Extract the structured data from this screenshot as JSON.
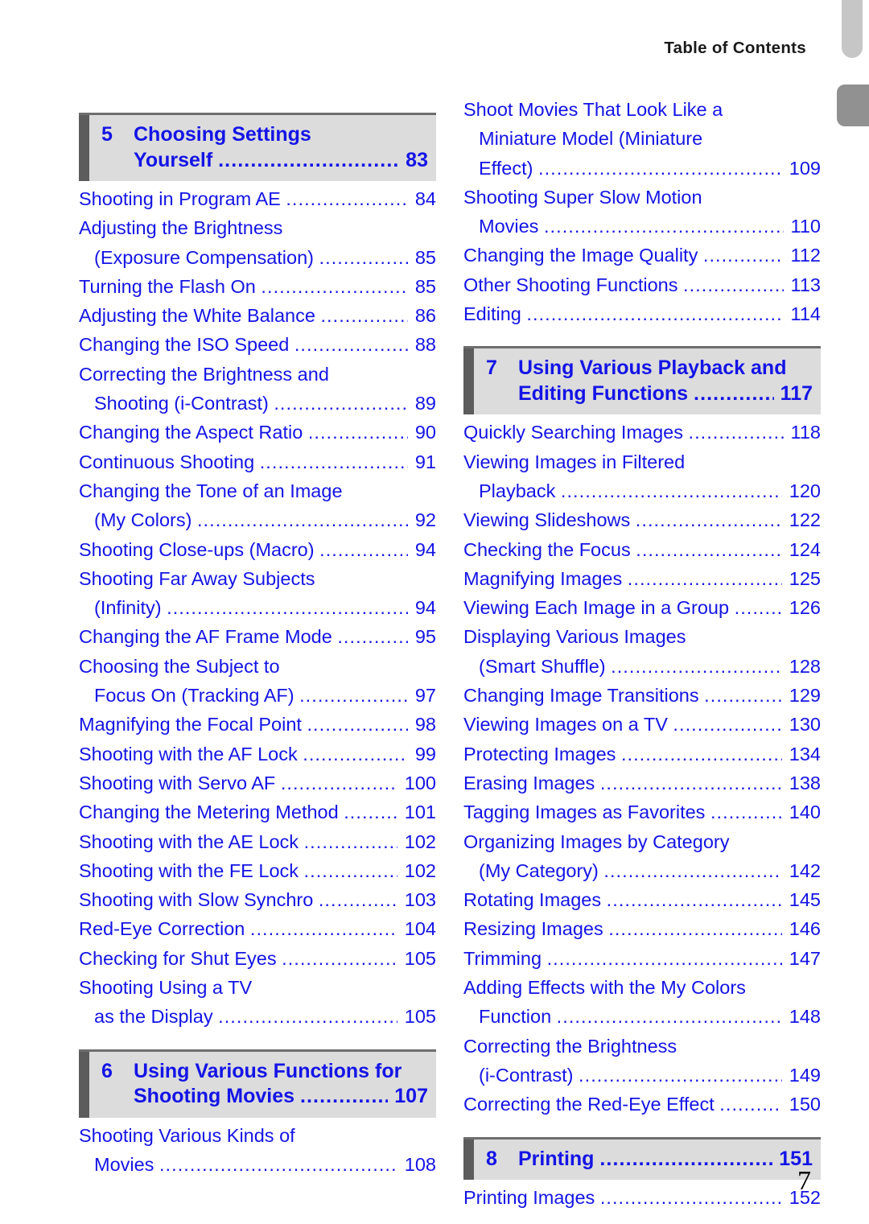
{
  "running_head": "Table of Contents",
  "folio": "7",
  "colors": {
    "link_blue": "#1414E6",
    "chapter_bar_bg": "#DCDCDC",
    "chapter_bar_accent": "#5C5C5C",
    "tab_light": "#C6C6C6",
    "tab_dark": "#919191"
  },
  "dot_leader": "........................................................................................",
  "left_column": [
    {
      "kind": "chapter",
      "number": "5",
      "lines": [
        {
          "label": "Choosing Settings",
          "dots": false,
          "page": ""
        },
        {
          "label": "Yourself",
          "dots": true,
          "page": "83"
        }
      ]
    },
    {
      "kind": "entry",
      "lines": [
        {
          "label": "Shooting in Program AE",
          "indent": false,
          "dots": true,
          "page": "84"
        }
      ]
    },
    {
      "kind": "entry",
      "lines": [
        {
          "label": "Adjusting the Brightness",
          "indent": false,
          "dots": false,
          "page": ""
        },
        {
          "label": "(Exposure Compensation)",
          "indent": true,
          "dots": true,
          "page": "85"
        }
      ]
    },
    {
      "kind": "entry",
      "lines": [
        {
          "label": "Turning the Flash On",
          "indent": false,
          "dots": true,
          "page": "85"
        }
      ]
    },
    {
      "kind": "entry",
      "lines": [
        {
          "label": "Adjusting the White Balance",
          "indent": false,
          "dots": true,
          "page": "86"
        }
      ]
    },
    {
      "kind": "entry",
      "lines": [
        {
          "label": "Changing the ISO Speed",
          "indent": false,
          "dots": true,
          "page": "88"
        }
      ]
    },
    {
      "kind": "entry",
      "lines": [
        {
          "label": "Correcting the Brightness and",
          "indent": false,
          "dots": false,
          "page": ""
        },
        {
          "label": "Shooting (i-Contrast)",
          "indent": true,
          "dots": true,
          "page": "89"
        }
      ]
    },
    {
      "kind": "entry",
      "lines": [
        {
          "label": "Changing the Aspect Ratio",
          "indent": false,
          "dots": true,
          "page": "90"
        }
      ]
    },
    {
      "kind": "entry",
      "lines": [
        {
          "label": "Continuous Shooting",
          "indent": false,
          "dots": true,
          "page": "91"
        }
      ]
    },
    {
      "kind": "entry",
      "lines": [
        {
          "label": "Changing the Tone of an Image",
          "indent": false,
          "dots": false,
          "page": ""
        },
        {
          "label": "(My Colors)",
          "indent": true,
          "dots": true,
          "page": "92"
        }
      ]
    },
    {
      "kind": "entry",
      "lines": [
        {
          "label": "Shooting Close-ups (Macro)",
          "indent": false,
          "dots": true,
          "page": "94"
        }
      ]
    },
    {
      "kind": "entry",
      "lines": [
        {
          "label": "Shooting Far Away Subjects",
          "indent": false,
          "dots": false,
          "page": ""
        },
        {
          "label": "(Infinity)",
          "indent": true,
          "dots": true,
          "page": "94"
        }
      ]
    },
    {
      "kind": "entry",
      "lines": [
        {
          "label": "Changing the AF Frame Mode",
          "indent": false,
          "dots": true,
          "page": "95"
        }
      ]
    },
    {
      "kind": "entry",
      "lines": [
        {
          "label": "Choosing the Subject to",
          "indent": false,
          "dots": false,
          "page": ""
        },
        {
          "label": "Focus On (Tracking AF)",
          "indent": true,
          "dots": true,
          "page": "97"
        }
      ]
    },
    {
      "kind": "entry",
      "lines": [
        {
          "label": "Magnifying the Focal Point",
          "indent": false,
          "dots": true,
          "page": "98"
        }
      ]
    },
    {
      "kind": "entry",
      "lines": [
        {
          "label": "Shooting with the AF Lock",
          "indent": false,
          "dots": true,
          "page": "99"
        }
      ]
    },
    {
      "kind": "entry",
      "lines": [
        {
          "label": "Shooting with Servo AF",
          "indent": false,
          "dots": true,
          "page": "100"
        }
      ]
    },
    {
      "kind": "entry",
      "lines": [
        {
          "label": "Changing the Metering Method",
          "indent": false,
          "dots": true,
          "page": "101"
        }
      ]
    },
    {
      "kind": "entry",
      "lines": [
        {
          "label": "Shooting with the AE Lock",
          "indent": false,
          "dots": true,
          "page": "102"
        }
      ]
    },
    {
      "kind": "entry",
      "lines": [
        {
          "label": "Shooting with the FE Lock",
          "indent": false,
          "dots": true,
          "page": "102"
        }
      ]
    },
    {
      "kind": "entry",
      "lines": [
        {
          "label": "Shooting with Slow Synchro",
          "indent": false,
          "dots": true,
          "page": "103"
        }
      ]
    },
    {
      "kind": "entry",
      "lines": [
        {
          "label": "Red-Eye Correction",
          "indent": false,
          "dots": true,
          "page": "104"
        }
      ]
    },
    {
      "kind": "entry",
      "lines": [
        {
          "label": "Checking for Shut Eyes",
          "indent": false,
          "dots": true,
          "page": "105"
        }
      ]
    },
    {
      "kind": "entry",
      "lines": [
        {
          "label": "Shooting Using a TV",
          "indent": false,
          "dots": false,
          "page": ""
        },
        {
          "label": "as the Display",
          "indent": true,
          "dots": true,
          "page": "105"
        }
      ]
    },
    {
      "kind": "chapter",
      "number": "6",
      "lines": [
        {
          "label": "Using Various Functions for",
          "dots": false,
          "page": ""
        },
        {
          "label": "Shooting Movies",
          "dots": true,
          "page": "107"
        }
      ]
    },
    {
      "kind": "entry",
      "lines": [
        {
          "label": "Shooting Various Kinds of",
          "indent": false,
          "dots": false,
          "page": ""
        },
        {
          "label": "Movies",
          "indent": true,
          "dots": true,
          "page": "108"
        }
      ]
    }
  ],
  "right_column": [
    {
      "kind": "entry",
      "lines": [
        {
          "label": "Shoot Movies That Look Like a",
          "indent": false,
          "dots": false,
          "page": ""
        },
        {
          "label": "Miniature Model (Miniature",
          "indent": true,
          "dots": false,
          "page": ""
        },
        {
          "label": "Effect)",
          "indent": true,
          "dots": true,
          "page": "109"
        }
      ]
    },
    {
      "kind": "entry",
      "lines": [
        {
          "label": "Shooting Super Slow Motion",
          "indent": false,
          "dots": false,
          "page": ""
        },
        {
          "label": "Movies",
          "indent": true,
          "dots": true,
          "page": "110"
        }
      ]
    },
    {
      "kind": "entry",
      "lines": [
        {
          "label": "Changing the Image Quality",
          "indent": false,
          "dots": true,
          "page": "112"
        }
      ]
    },
    {
      "kind": "entry",
      "lines": [
        {
          "label": "Other Shooting Functions",
          "indent": false,
          "dots": true,
          "page": "113"
        }
      ]
    },
    {
      "kind": "entry",
      "lines": [
        {
          "label": "Editing",
          "indent": false,
          "dots": true,
          "page": "114"
        }
      ]
    },
    {
      "kind": "chapter",
      "number": "7",
      "lines": [
        {
          "label": "Using Various Playback and",
          "dots": false,
          "page": ""
        },
        {
          "label": "Editing Functions",
          "dots": true,
          "page": "117"
        }
      ]
    },
    {
      "kind": "entry",
      "lines": [
        {
          "label": "Quickly Searching Images",
          "indent": false,
          "dots": true,
          "page": "118"
        }
      ]
    },
    {
      "kind": "entry",
      "lines": [
        {
          "label": "Viewing Images in Filtered",
          "indent": false,
          "dots": false,
          "page": ""
        },
        {
          "label": "Playback",
          "indent": true,
          "dots": true,
          "page": "120"
        }
      ]
    },
    {
      "kind": "entry",
      "lines": [
        {
          "label": "Viewing Slideshows",
          "indent": false,
          "dots": true,
          "page": "122"
        }
      ]
    },
    {
      "kind": "entry",
      "lines": [
        {
          "label": "Checking the Focus",
          "indent": false,
          "dots": true,
          "page": "124"
        }
      ]
    },
    {
      "kind": "entry",
      "lines": [
        {
          "label": "Magnifying Images",
          "indent": false,
          "dots": true,
          "page": "125"
        }
      ]
    },
    {
      "kind": "entry",
      "lines": [
        {
          "label": "Viewing Each Image in a Group",
          "indent": false,
          "dots": true,
          "page": "126"
        }
      ]
    },
    {
      "kind": "entry",
      "lines": [
        {
          "label": "Displaying Various Images",
          "indent": false,
          "dots": false,
          "page": ""
        },
        {
          "label": "(Smart Shuffle)",
          "indent": true,
          "dots": true,
          "page": "128"
        }
      ]
    },
    {
      "kind": "entry",
      "lines": [
        {
          "label": "Changing Image Transitions",
          "indent": false,
          "dots": true,
          "page": "129"
        }
      ]
    },
    {
      "kind": "entry",
      "lines": [
        {
          "label": "Viewing Images on a TV",
          "indent": false,
          "dots": true,
          "page": "130"
        }
      ]
    },
    {
      "kind": "entry",
      "lines": [
        {
          "label": "Protecting Images",
          "indent": false,
          "dots": true,
          "page": "134"
        }
      ]
    },
    {
      "kind": "entry",
      "lines": [
        {
          "label": "Erasing Images",
          "indent": false,
          "dots": true,
          "page": "138"
        }
      ]
    },
    {
      "kind": "entry",
      "lines": [
        {
          "label": "Tagging Images as Favorites",
          "indent": false,
          "dots": true,
          "page": "140"
        }
      ]
    },
    {
      "kind": "entry",
      "lines": [
        {
          "label": "Organizing Images by Category",
          "indent": false,
          "dots": false,
          "page": ""
        },
        {
          "label": "(My Category)",
          "indent": true,
          "dots": true,
          "page": "142"
        }
      ]
    },
    {
      "kind": "entry",
      "lines": [
        {
          "label": "Rotating Images",
          "indent": false,
          "dots": true,
          "page": "145"
        }
      ]
    },
    {
      "kind": "entry",
      "lines": [
        {
          "label": "Resizing Images",
          "indent": false,
          "dots": true,
          "page": "146"
        }
      ]
    },
    {
      "kind": "entry",
      "lines": [
        {
          "label": "Trimming",
          "indent": false,
          "dots": true,
          "page": "147"
        }
      ]
    },
    {
      "kind": "entry",
      "lines": [
        {
          "label": "Adding Effects with the My Colors",
          "indent": false,
          "dots": false,
          "page": ""
        },
        {
          "label": "Function",
          "indent": true,
          "dots": true,
          "page": "148"
        }
      ]
    },
    {
      "kind": "entry",
      "lines": [
        {
          "label": "Correcting the Brightness",
          "indent": false,
          "dots": false,
          "page": ""
        },
        {
          "label": "(i-Contrast)",
          "indent": true,
          "dots": true,
          "page": "149"
        }
      ]
    },
    {
      "kind": "entry",
      "lines": [
        {
          "label": "Correcting the Red-Eye Effect",
          "indent": false,
          "dots": true,
          "page": "150"
        }
      ]
    },
    {
      "kind": "chapter",
      "number": "8",
      "lines": [
        {
          "label": "Printing",
          "dots": true,
          "page": "151"
        }
      ]
    },
    {
      "kind": "entry",
      "lines": [
        {
          "label": "Printing Images",
          "indent": false,
          "dots": true,
          "page": "152"
        }
      ]
    }
  ]
}
